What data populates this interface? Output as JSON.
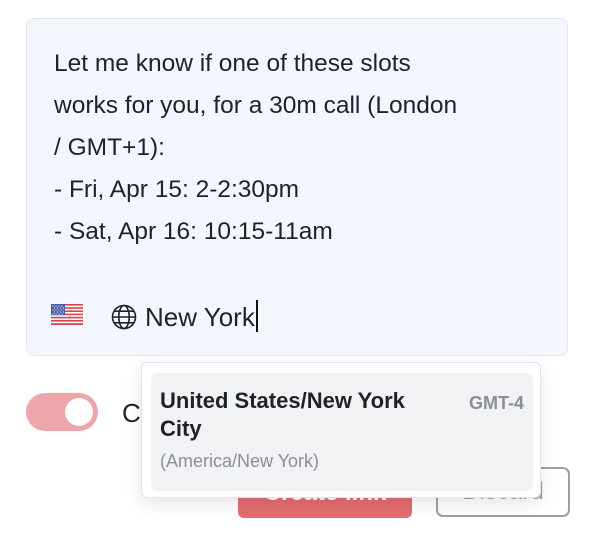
{
  "message": {
    "lines": [
      "Let me know if one of these slots",
      "works for you, for a 30m call (London",
      "/ GMT+1):",
      "- Fri, Apr 15: 2-2:30pm",
      "- Sat, Apr 16: 10:15-11am"
    ]
  },
  "timezone_input": {
    "flag_icon": "us-flag-icon",
    "globe_icon": "globe-icon",
    "value": "New York"
  },
  "toggle": {
    "state": "on",
    "label": "C",
    "color": "#eda6a9"
  },
  "buttons": {
    "create_label": "Create link",
    "discard_label": "Discard",
    "create_color": "#e46c6e"
  },
  "dropdown": {
    "options": [
      {
        "name": "United States/New York City",
        "iana": "(America/New York)",
        "offset": "GMT-4",
        "highlighted": true
      }
    ]
  }
}
